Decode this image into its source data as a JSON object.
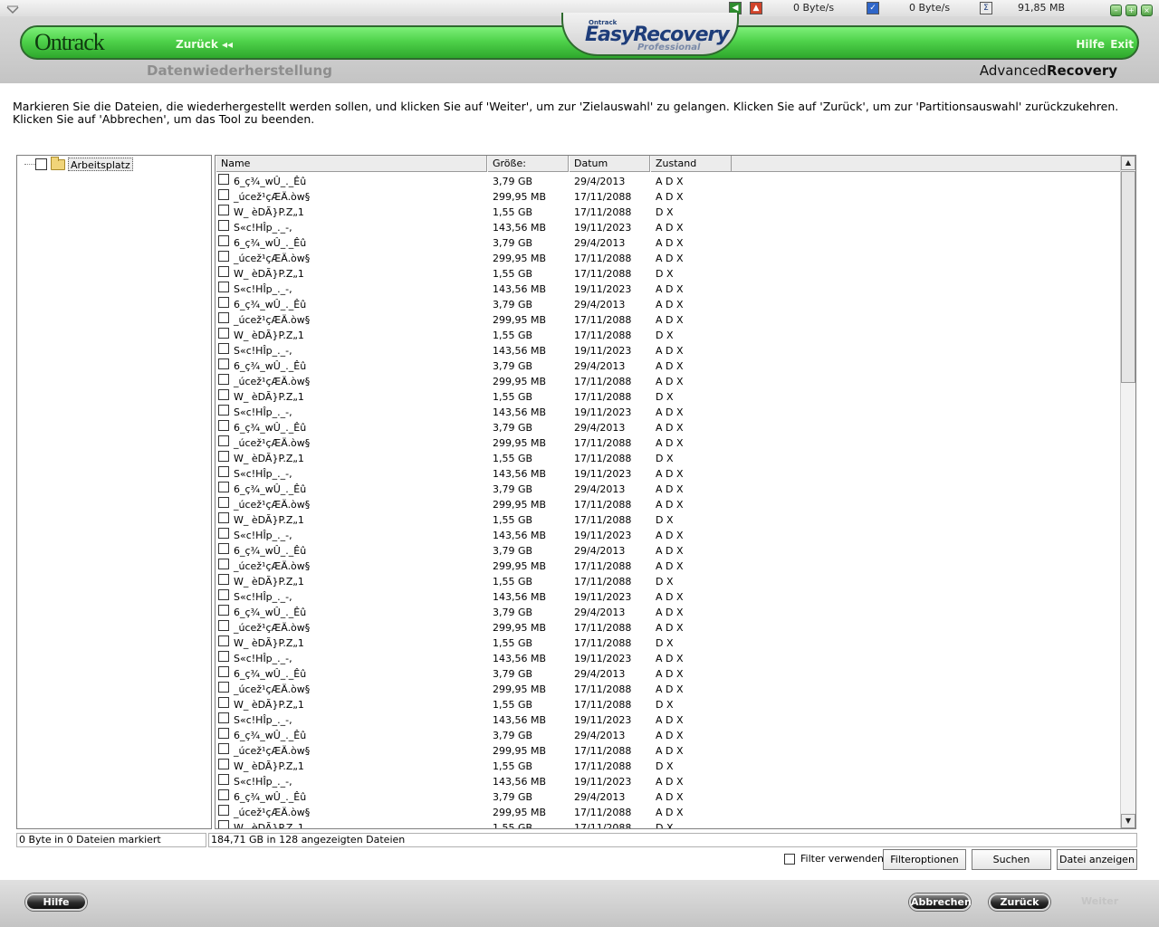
{
  "titlebar": {
    "stat1": "0 Byte/s",
    "stat2": "0 Byte/s",
    "stat3": "91,85 MB",
    "icons": [
      "back-arrow-icon",
      "forward-arrow-icon",
      "checkbox-icon",
      "sigma-icon"
    ]
  },
  "header": {
    "logo": "Ontrack",
    "back": "Zurück",
    "help": "Hilfe",
    "exit": "Exit",
    "brand_small": "Ontrack",
    "brand_main": "EasyRecovery",
    "brand_sub": "Professional",
    "section_title": "Datenwiederherstellung",
    "tool_name_a": "Advanced",
    "tool_name_b": "Recovery"
  },
  "instructions": "Markieren Sie die Dateien, die wiederhergestellt werden sollen, und klicken Sie auf 'Weiter', um zur 'Zielauswahl' zu gelangen. Klicken Sie auf 'Zurück', um zur 'Partitionsauswahl' zurückzukehren. Klicken Sie auf 'Abbrechen', um das Tool zu beenden.",
  "tree": {
    "root_label": "Arbeitsplatz"
  },
  "columns": [
    "Name",
    "Größe:",
    "Datum",
    "Zustand"
  ],
  "row_pattern": [
    {
      "name": "6_ç¾_wÛ_._Êû",
      "size": "3,79 GB",
      "date": "29/4/2013",
      "state": "A D X"
    },
    {
      "name": "_úcež¹çÆÄ.òw§",
      "size": "299,95 MB",
      "date": "17/11/2088",
      "state": "A D X"
    },
    {
      "name": "W_ èDÃ}P.Z„1",
      "size": "1,55 GB",
      "date": "17/11/2088",
      "state": "D X"
    },
    {
      "name": "S«c!HÎp_._-,",
      "size": "143,56 MB",
      "date": "19/11/2023",
      "state": "A D X"
    }
  ],
  "rows_visible": 43,
  "status": {
    "left": "0 Byte in 0 Dateien markiert",
    "right": "184,71 GB in 128 angezeigten Dateien"
  },
  "filter": {
    "label": "Filter verwenden",
    "options_btn": "Filteroptionen",
    "search_btn": "Suchen",
    "show_btn": "Datei anzeigen"
  },
  "footer": {
    "help": "Hilfe",
    "cancel": "Abbrechen",
    "back": "Zurück",
    "next": "Weiter"
  },
  "colors": {
    "green_bar": "#4fd24b",
    "brand_blue": "#1e3d7a"
  }
}
